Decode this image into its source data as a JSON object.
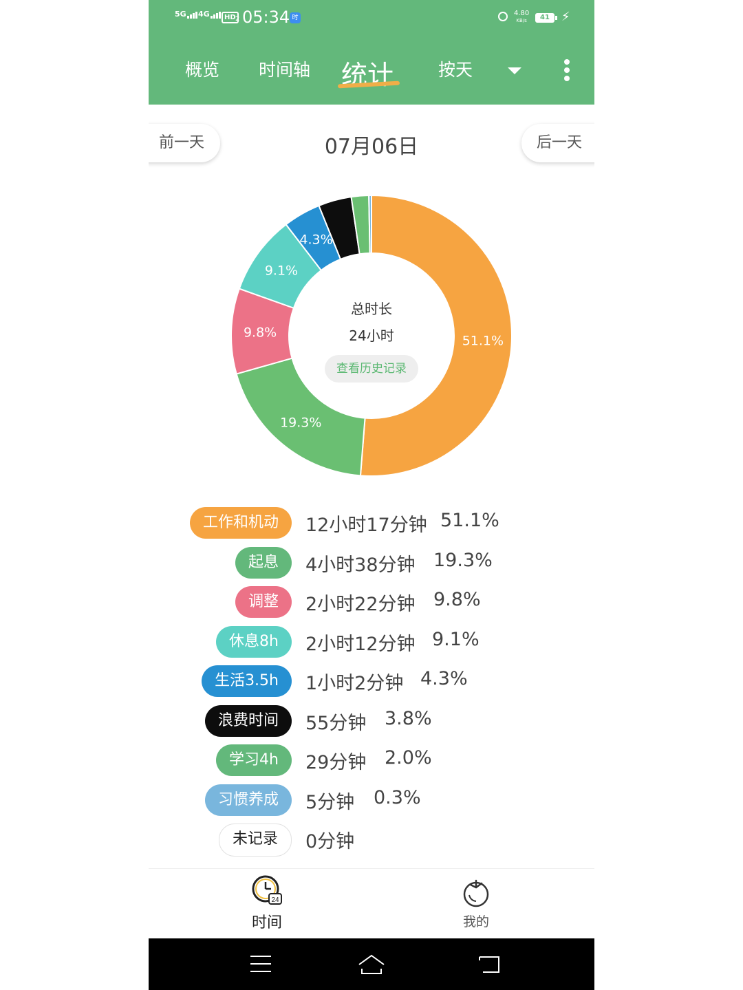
{
  "status_bar": {
    "time": "05:34",
    "signal_1": "5G",
    "signal_2": "4G",
    "hd_badge": "HD",
    "hd_sub": "2",
    "app_icon_text": "时",
    "net_speed": "4.80",
    "net_speed_unit": "KB/s",
    "battery": "41"
  },
  "header": {
    "tabs": [
      {
        "label": "概览"
      },
      {
        "label": "时间轴"
      },
      {
        "label": "统计"
      },
      {
        "label": "按天"
      }
    ],
    "active_tab": "统计",
    "accent_color": "#63b87b",
    "dropdown_icon": "caret-down-icon",
    "more_icon": "vertical-dots-icon"
  },
  "date_nav": {
    "prev_label": "前一天",
    "date": "07月06日",
    "next_label": "后一天"
  },
  "summary": {
    "title": "总时长",
    "total": "24小时",
    "history_button": "查看历史记录"
  },
  "chart_data": {
    "type": "pie",
    "style": "donut",
    "total_hours": 24,
    "slices": [
      {
        "name": "工作和机动",
        "value": 51.1,
        "label": "51.1%",
        "color": "#f6a441"
      },
      {
        "name": "起息",
        "value": 19.3,
        "label": "19.3%",
        "color": "#6abf72"
      },
      {
        "name": "调整",
        "value": 9.8,
        "label": "9.8%",
        "color": "#ec7287"
      },
      {
        "name": "休息8h",
        "value": 9.1,
        "label": "9.1%",
        "color": "#5cd1c4"
      },
      {
        "name": "生活3.5h",
        "value": 4.3,
        "label": "4.3%",
        "color": "#2690d2"
      },
      {
        "name": "浪费时间",
        "value": 3.8,
        "label": "",
        "color": "#0d0d0d"
      },
      {
        "name": "学习4h",
        "value": 2.0,
        "label": "",
        "color": "#6abf72"
      },
      {
        "name": "习惯养成",
        "value": 0.3,
        "label": "",
        "color": "#79b6dd"
      }
    ]
  },
  "legend": [
    {
      "name": "工作和机动",
      "duration": "12小时17分钟",
      "percent": "51.1%",
      "color": "#f6a441"
    },
    {
      "name": "起息",
      "duration": "4小时38分钟",
      "percent": "19.3%",
      "color": "#63b87b"
    },
    {
      "name": "调整",
      "duration": "2小时22分钟",
      "percent": "9.8%",
      "color": "#ec7287"
    },
    {
      "name": "休息8h",
      "duration": "2小时12分钟",
      "percent": "9.1%",
      "color": "#5cd1c4"
    },
    {
      "name": "生活3.5h",
      "duration": "1小时2分钟",
      "percent": "4.3%",
      "color": "#2690d2"
    },
    {
      "name": "浪费时间",
      "duration": "55分钟",
      "percent": "3.8%",
      "color": "#0d0d0d"
    },
    {
      "name": "学习4h",
      "duration": "29分钟",
      "percent": "2.0%",
      "color": "#63b87b"
    },
    {
      "name": "习惯养成",
      "duration": "5分钟",
      "percent": "0.3%",
      "color": "#79b6dd"
    },
    {
      "name": "未记录",
      "duration": "0分钟",
      "percent": "",
      "color": "#ffffff"
    }
  ],
  "bottom_nav": {
    "tabs": [
      {
        "label": "时间",
        "icon": "clock-24-icon"
      },
      {
        "label": "我的",
        "icon": "tomato-icon"
      }
    ]
  },
  "system_nav": {
    "icons": [
      "menu-icon",
      "home-icon",
      "back-icon"
    ]
  }
}
